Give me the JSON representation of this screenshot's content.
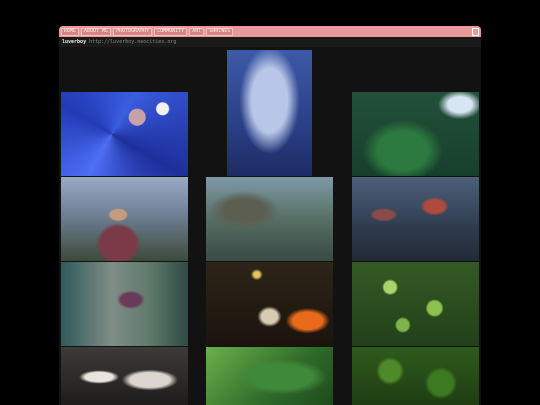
{
  "nav": {
    "items": [
      "HOME",
      "ABOUT ME",
      "PHOTOGRAPHY",
      "COMMUNITY",
      "ART",
      "SHRINES"
    ]
  },
  "site": {
    "name": "luverboy",
    "url": "http://luverboy.neocities.org"
  },
  "gallery": {
    "photos": [
      {
        "name": "photo-blue-mosaic",
        "scene": "p-mosaic"
      },
      {
        "name": "photo-garden-arch",
        "scene": "p-arch"
      },
      {
        "name": "photo-fern-tree",
        "scene": "p-fern"
      },
      {
        "name": "photo-girl-flowers",
        "scene": "p-girl1"
      },
      {
        "name": "photo-oak-branches",
        "scene": "p-tree"
      },
      {
        "name": "photo-girl-reclining",
        "scene": "p-girl2"
      },
      {
        "name": "photo-garden-path",
        "scene": "p-path"
      },
      {
        "name": "photo-statue-vase",
        "scene": "p-statue"
      },
      {
        "name": "photo-jade-plant",
        "scene": "p-jade"
      },
      {
        "name": "photo-cat",
        "scene": "p-cat"
      },
      {
        "name": "photo-monstera-leaf",
        "scene": "p-monstera"
      },
      {
        "name": "photo-green-leaves",
        "scene": "p-leaves"
      }
    ]
  },
  "colors": {
    "navbar": "#e89a9a",
    "background": "#121212"
  }
}
